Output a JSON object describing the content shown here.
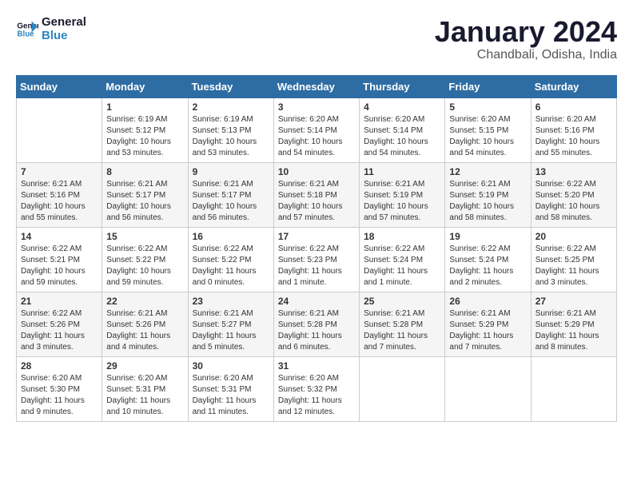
{
  "header": {
    "logo_line1": "General",
    "logo_line2": "Blue",
    "month": "January 2024",
    "location": "Chandbali, Odisha, India"
  },
  "weekdays": [
    "Sunday",
    "Monday",
    "Tuesday",
    "Wednesday",
    "Thursday",
    "Friday",
    "Saturday"
  ],
  "weeks": [
    [
      {
        "day": "",
        "info": ""
      },
      {
        "day": "1",
        "info": "Sunrise: 6:19 AM\nSunset: 5:12 PM\nDaylight: 10 hours\nand 53 minutes."
      },
      {
        "day": "2",
        "info": "Sunrise: 6:19 AM\nSunset: 5:13 PM\nDaylight: 10 hours\nand 53 minutes."
      },
      {
        "day": "3",
        "info": "Sunrise: 6:20 AM\nSunset: 5:14 PM\nDaylight: 10 hours\nand 54 minutes."
      },
      {
        "day": "4",
        "info": "Sunrise: 6:20 AM\nSunset: 5:14 PM\nDaylight: 10 hours\nand 54 minutes."
      },
      {
        "day": "5",
        "info": "Sunrise: 6:20 AM\nSunset: 5:15 PM\nDaylight: 10 hours\nand 54 minutes."
      },
      {
        "day": "6",
        "info": "Sunrise: 6:20 AM\nSunset: 5:16 PM\nDaylight: 10 hours\nand 55 minutes."
      }
    ],
    [
      {
        "day": "7",
        "info": "Sunrise: 6:21 AM\nSunset: 5:16 PM\nDaylight: 10 hours\nand 55 minutes."
      },
      {
        "day": "8",
        "info": "Sunrise: 6:21 AM\nSunset: 5:17 PM\nDaylight: 10 hours\nand 56 minutes."
      },
      {
        "day": "9",
        "info": "Sunrise: 6:21 AM\nSunset: 5:17 PM\nDaylight: 10 hours\nand 56 minutes."
      },
      {
        "day": "10",
        "info": "Sunrise: 6:21 AM\nSunset: 5:18 PM\nDaylight: 10 hours\nand 57 minutes."
      },
      {
        "day": "11",
        "info": "Sunrise: 6:21 AM\nSunset: 5:19 PM\nDaylight: 10 hours\nand 57 minutes."
      },
      {
        "day": "12",
        "info": "Sunrise: 6:21 AM\nSunset: 5:19 PM\nDaylight: 10 hours\nand 58 minutes."
      },
      {
        "day": "13",
        "info": "Sunrise: 6:22 AM\nSunset: 5:20 PM\nDaylight: 10 hours\nand 58 minutes."
      }
    ],
    [
      {
        "day": "14",
        "info": "Sunrise: 6:22 AM\nSunset: 5:21 PM\nDaylight: 10 hours\nand 59 minutes."
      },
      {
        "day": "15",
        "info": "Sunrise: 6:22 AM\nSunset: 5:22 PM\nDaylight: 10 hours\nand 59 minutes."
      },
      {
        "day": "16",
        "info": "Sunrise: 6:22 AM\nSunset: 5:22 PM\nDaylight: 11 hours\nand 0 minutes."
      },
      {
        "day": "17",
        "info": "Sunrise: 6:22 AM\nSunset: 5:23 PM\nDaylight: 11 hours\nand 1 minute."
      },
      {
        "day": "18",
        "info": "Sunrise: 6:22 AM\nSunset: 5:24 PM\nDaylight: 11 hours\nand 1 minute."
      },
      {
        "day": "19",
        "info": "Sunrise: 6:22 AM\nSunset: 5:24 PM\nDaylight: 11 hours\nand 2 minutes."
      },
      {
        "day": "20",
        "info": "Sunrise: 6:22 AM\nSunset: 5:25 PM\nDaylight: 11 hours\nand 3 minutes."
      }
    ],
    [
      {
        "day": "21",
        "info": "Sunrise: 6:22 AM\nSunset: 5:26 PM\nDaylight: 11 hours\nand 3 minutes."
      },
      {
        "day": "22",
        "info": "Sunrise: 6:21 AM\nSunset: 5:26 PM\nDaylight: 11 hours\nand 4 minutes."
      },
      {
        "day": "23",
        "info": "Sunrise: 6:21 AM\nSunset: 5:27 PM\nDaylight: 11 hours\nand 5 minutes."
      },
      {
        "day": "24",
        "info": "Sunrise: 6:21 AM\nSunset: 5:28 PM\nDaylight: 11 hours\nand 6 minutes."
      },
      {
        "day": "25",
        "info": "Sunrise: 6:21 AM\nSunset: 5:28 PM\nDaylight: 11 hours\nand 7 minutes."
      },
      {
        "day": "26",
        "info": "Sunrise: 6:21 AM\nSunset: 5:29 PM\nDaylight: 11 hours\nand 7 minutes."
      },
      {
        "day": "27",
        "info": "Sunrise: 6:21 AM\nSunset: 5:29 PM\nDaylight: 11 hours\nand 8 minutes."
      }
    ],
    [
      {
        "day": "28",
        "info": "Sunrise: 6:20 AM\nSunset: 5:30 PM\nDaylight: 11 hours\nand 9 minutes."
      },
      {
        "day": "29",
        "info": "Sunrise: 6:20 AM\nSunset: 5:31 PM\nDaylight: 11 hours\nand 10 minutes."
      },
      {
        "day": "30",
        "info": "Sunrise: 6:20 AM\nSunset: 5:31 PM\nDaylight: 11 hours\nand 11 minutes."
      },
      {
        "day": "31",
        "info": "Sunrise: 6:20 AM\nSunset: 5:32 PM\nDaylight: 11 hours\nand 12 minutes."
      },
      {
        "day": "",
        "info": ""
      },
      {
        "day": "",
        "info": ""
      },
      {
        "day": "",
        "info": ""
      }
    ]
  ]
}
